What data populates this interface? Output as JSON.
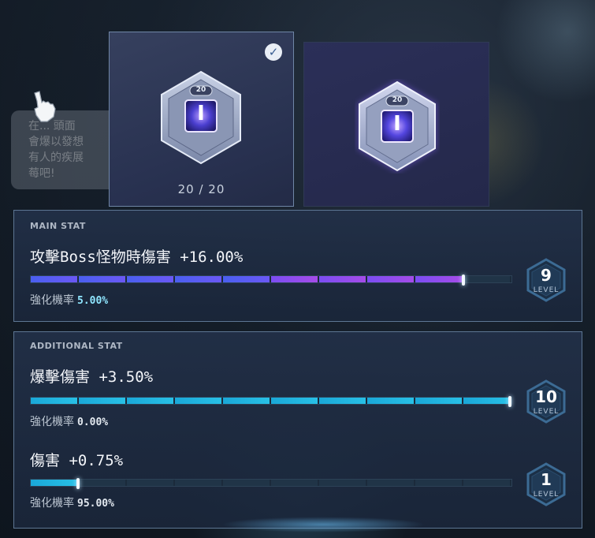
{
  "background_bubble": {
    "lines": [
      "在... 頭面",
      "會爆以發想",
      "有人的疾展",
      "莓吧!"
    ]
  },
  "cards": [
    {
      "selected": true,
      "gem_level": "20",
      "gem_letter": "I",
      "count": "20 / 20"
    },
    {
      "selected": false,
      "gem_level": "20",
      "gem_letter": "I"
    }
  ],
  "main_stat": {
    "label": "MAIN STAT",
    "name": "攻擊Boss怪物時傷害 +16.00%",
    "rate_label": "強化機率",
    "rate_value": "5.00%",
    "level": "9",
    "level_label": "LEVEL",
    "progress": 0.9
  },
  "additional_stat": {
    "label": "ADDITIONAL STAT",
    "stats": [
      {
        "name": "爆擊傷害 +3.50%",
        "rate_label": "強化機率",
        "rate_value": "0.00%",
        "level": "10",
        "level_label": "LEVEL",
        "progress": 1.0
      },
      {
        "name": "傷害 +0.75%",
        "rate_label": "強化機率",
        "rate_value": "95.00%",
        "level": "1",
        "level_label": "LEVEL",
        "progress": 0.1
      }
    ]
  },
  "colors": {
    "main_bar": "#6b58f5",
    "additional_bar": "#28c0e6",
    "rate_highlight": "#8fe6ff"
  }
}
